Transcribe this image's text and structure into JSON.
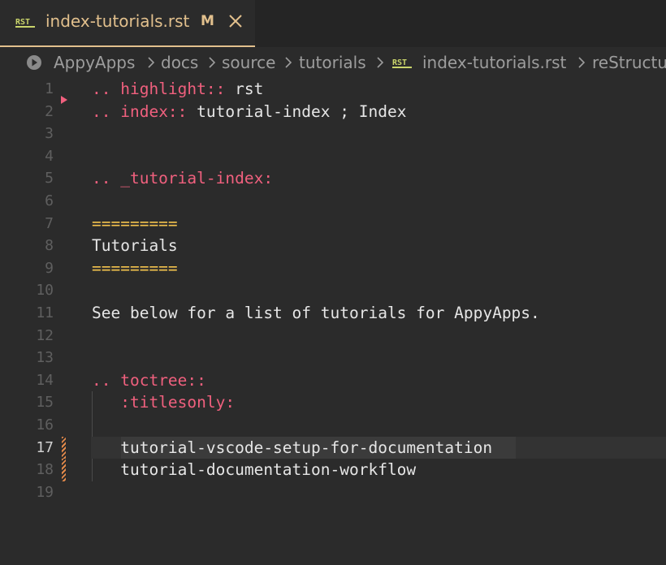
{
  "tab": {
    "badge": "RST",
    "title": "index-tutorials.rst",
    "modified": "M"
  },
  "breadcrumb": {
    "items": [
      "AppyApps",
      "docs",
      "source",
      "tutorials",
      "index-tutorials.rst",
      "reStructu"
    ],
    "file_badge": "RST"
  },
  "editor": {
    "active_line": 17,
    "lines": [
      {
        "n": "1",
        "tokens": [
          {
            "t": ".. ",
            "c": "pink"
          },
          {
            "t": "highlight::",
            "c": "pink"
          },
          {
            "t": " rst",
            "c": "white"
          }
        ]
      },
      {
        "n": "2",
        "tokens": [
          {
            "t": ".. ",
            "c": "pink"
          },
          {
            "t": "index::",
            "c": "pink"
          },
          {
            "t": " tutorial-index ; Index",
            "c": "white"
          }
        ]
      },
      {
        "n": "3",
        "tokens": []
      },
      {
        "n": "4",
        "tokens": []
      },
      {
        "n": "5",
        "tokens": [
          {
            "t": ".. _tutorial-index:",
            "c": "pink"
          }
        ]
      },
      {
        "n": "6",
        "tokens": []
      },
      {
        "n": "7",
        "tokens": [
          {
            "t": "=========",
            "c": "yellow"
          }
        ]
      },
      {
        "n": "8",
        "tokens": [
          {
            "t": "Tutorials",
            "c": "white"
          }
        ]
      },
      {
        "n": "9",
        "tokens": [
          {
            "t": "=========",
            "c": "yellow"
          }
        ]
      },
      {
        "n": "10",
        "tokens": []
      },
      {
        "n": "11",
        "tokens": [
          {
            "t": "See below for a list of tutorials for AppyApps.",
            "c": "white"
          }
        ]
      },
      {
        "n": "12",
        "tokens": []
      },
      {
        "n": "13",
        "tokens": []
      },
      {
        "n": "14",
        "tokens": [
          {
            "t": ".. ",
            "c": "pink"
          },
          {
            "t": "toctree::",
            "c": "pink"
          }
        ]
      },
      {
        "n": "15",
        "tokens": [
          {
            "t": "   :titlesonly:",
            "c": "pink"
          }
        ]
      },
      {
        "n": "16",
        "tokens": []
      },
      {
        "n": "17",
        "tokens": [
          {
            "t": "   tutorial-vscode-setup-for-documentation",
            "c": "white"
          }
        ]
      },
      {
        "n": "18",
        "tokens": [
          {
            "t": "   tutorial-documentation-workflow",
            "c": "white"
          }
        ]
      },
      {
        "n": "19",
        "tokens": []
      }
    ]
  },
  "colors": {
    "pink": "#f0607e",
    "yellow": "#f4c44e",
    "tab_accent": "#e2c08d",
    "background": "#2b2b2b"
  },
  "icons": [
    "rst-file-icon",
    "close-icon",
    "run-icon",
    "chevron-right-icon",
    "fold-arrow-icon"
  ]
}
